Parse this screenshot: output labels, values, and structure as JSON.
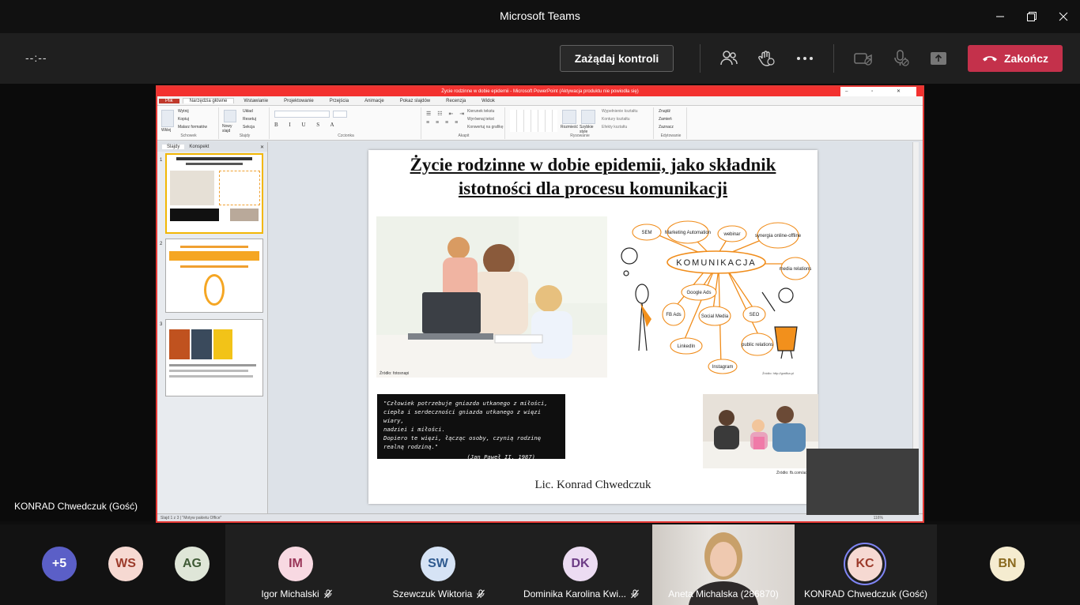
{
  "window": {
    "title": "Microsoft Teams"
  },
  "toolbar": {
    "timer": "--:--",
    "request_control_label": "Zażądaj kontroli",
    "end_call_label": "Zakończ"
  },
  "stage": {
    "presenter_label": "KONRAD Chwedczuk (Gość)"
  },
  "ppt": {
    "title": "Życie rodzinne w dobie epidemii - Microsoft PowerPoint (Aktywacja produktu nie powiodła się)",
    "file_tab": "Plik",
    "tabs": [
      "Narzędzia główne",
      "Wstawianie",
      "Projektowanie",
      "Przejścia",
      "Animacje",
      "Pokaz slajdów",
      "Recenzja",
      "Widok"
    ],
    "ribbon_groups": [
      "Schowek",
      "Slajdy",
      "Czcionka",
      "Akapit",
      "Rysowanie",
      "Edytowanie"
    ],
    "ribbon_buttons": [
      "Wklej",
      "Wytnij",
      "Kopiuj",
      "Malarz formatów",
      "Nowy slajd",
      "Układ",
      "Resetuj",
      "Sekcja",
      "Kierunek tekstu",
      "Wyrównaj tekst",
      "Konwertuj na grafikę SmartArt",
      "Rozmieść",
      "Szybkie style",
      "Wypełnienie kształtu",
      "Kontury kształtu",
      "Efekty kształtu",
      "Znajdź",
      "Zamień",
      "Zaznacz"
    ],
    "panel_tabs": [
      "Slajdy",
      "Konspekt"
    ],
    "slide_numbers": [
      "1",
      "2",
      "3"
    ],
    "status": "Slajd 1 z 3  |  \"Motyw pakietu Office\"",
    "zoom": "116%"
  },
  "slide": {
    "title": "Życie rodzinne w dobie epidemii, jako składnik istotności dla procesu komunikacji",
    "photo1_caption": "Źródło: fotosnapi",
    "mindmap_center": "KOMUNIKACJA",
    "mindmap_nodes": [
      "SEM",
      "Marketing Automation",
      "webinar",
      "synergia online-offline",
      "media relations",
      "Google Ads",
      "FB Ads",
      "Social Media",
      "SEO",
      "LinkedIn",
      "public relations",
      "Instagram"
    ],
    "mindmap_caption": "Źródło: http://grafika.pl",
    "quote_lines": [
      "\"Człowiek potrzebuje gniazda utkanego z miłości,",
      "ciepła i serdeczności gniazda utkanego z więzi wiary,",
      "nadziei i miłości.",
      "Dopiero te więzi, łącząc osoby, czynią rodzinę",
      "realną rodziną.\""
    ],
    "quote_author": "(Jan Paweł II, 1987)",
    "photo2_caption": "Źródło: fb.com/aduluru",
    "author": "Lic. Konrad Chwedczuk"
  },
  "participants": [
    {
      "initials": "+5",
      "color": "#5b5fc7",
      "text_color": "#ffffff"
    },
    {
      "initials": "WS",
      "color": "#f6d9d2",
      "text_color": "#9c3b2b"
    },
    {
      "initials": "AG",
      "color": "#dfe6d8",
      "text_color": "#3f5a36"
    },
    {
      "initials": "IM",
      "color": "#f8d9e2",
      "text_color": "#9a3558",
      "name": "Igor Michalski"
    },
    {
      "initials": "SW",
      "color": "#d6e3f5",
      "text_color": "#2f5a8f",
      "name": "Szewczuk Wiktoria"
    },
    {
      "initials": "DK",
      "color": "#ecdcf2",
      "text_color": "#6c3b85",
      "name": "Dominika Karolina Kwi..."
    },
    {
      "name": "Aneta Michalska (286870)"
    },
    {
      "initials": "KC",
      "color": "#f6d9d2",
      "text_color": "#9c3b2b",
      "name": "KONRAD Chwedczuk (Gość)"
    },
    {
      "initials": "BN",
      "color": "#f5ecd0",
      "text_color": "#8a6a1f"
    }
  ]
}
